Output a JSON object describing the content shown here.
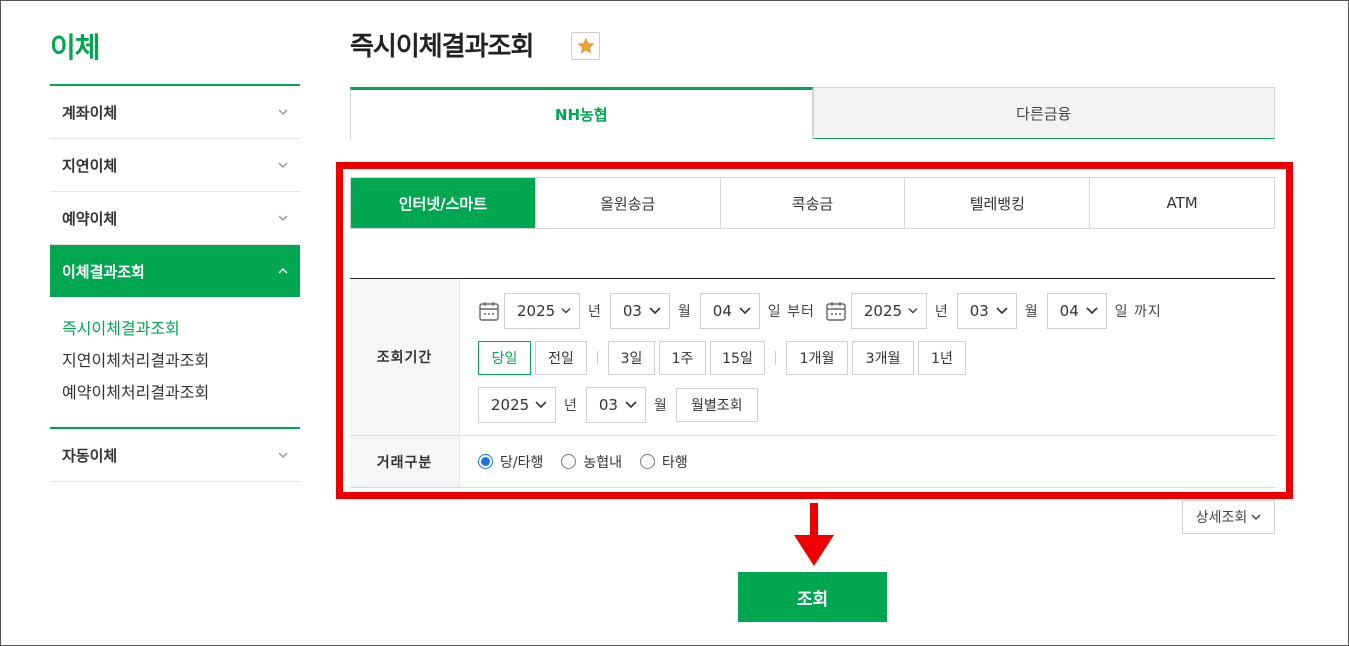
{
  "sidebar": {
    "title": "이체",
    "items": [
      {
        "label": "계좌이체"
      },
      {
        "label": "지연이체"
      },
      {
        "label": "예약이체"
      },
      {
        "label": "이체결과조회"
      },
      {
        "label": "자동이체"
      }
    ],
    "sub_items": [
      {
        "label": "즉시이체결과조회"
      },
      {
        "label": "지연이체처리결과조회"
      },
      {
        "label": "예약이체처리결과조회"
      }
    ]
  },
  "header": {
    "title": "즉시이체결과조회"
  },
  "bank_tabs": [
    {
      "label": "NH농협"
    },
    {
      "label": "다른금융"
    }
  ],
  "channel_tabs": [
    {
      "label": "인터넷/스마트"
    },
    {
      "label": "올원송금"
    },
    {
      "label": "콕송금"
    },
    {
      "label": "텔레뱅킹"
    },
    {
      "label": "ATM"
    }
  ],
  "form": {
    "period": {
      "label": "조회기간",
      "from_year": "2025",
      "from_month": "03",
      "from_day": "04",
      "to_year": "2025",
      "to_month": "03",
      "to_day": "04",
      "unit_year": "년",
      "unit_month": "월",
      "unit_from": "일 부터",
      "unit_to": "일 까지",
      "quick": [
        {
          "label": "당일"
        },
        {
          "label": "전일"
        },
        {
          "label": "3일"
        },
        {
          "label": "1주"
        },
        {
          "label": "15일"
        },
        {
          "label": "1개월"
        },
        {
          "label": "3개월"
        },
        {
          "label": "1년"
        }
      ],
      "month_year": "2025",
      "month_month": "03",
      "monthly_button": "월별조회"
    },
    "type": {
      "label": "거래구분",
      "options": [
        {
          "label": "당/타행"
        },
        {
          "label": "농협내"
        },
        {
          "label": "타행"
        }
      ]
    }
  },
  "detail_button": "상세조회",
  "submit_button": "조회",
  "colors": {
    "brand": "#00a650",
    "highlight": "#ee0000",
    "radio": "#1a73e8"
  }
}
